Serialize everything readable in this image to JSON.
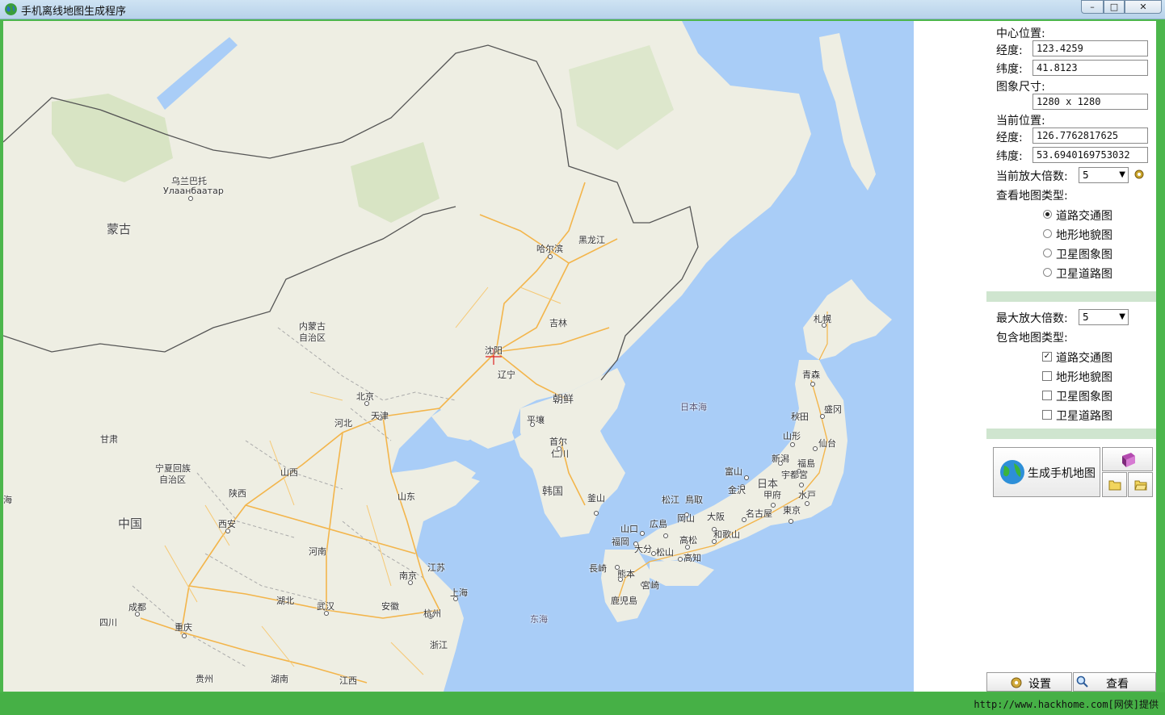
{
  "window": {
    "title": "手机离线地图生成程序",
    "controls": {
      "minimize": "–",
      "maximize": "□",
      "close": "✕"
    }
  },
  "map": {
    "labels": {
      "mongolia": "蒙古",
      "ulaanbaatar_cn": "乌兰巴托",
      "ulaanbaatar_ru": "Улаанбаатар",
      "inner_mongolia_1": "内蒙古",
      "inner_mongolia_2": "自治区",
      "heilongjiang": "黑龙江",
      "harbin": "哈尔滨",
      "jilin": "吉林",
      "shenyang": "沈阳",
      "liaoning": "辽宁",
      "beijing": "北京",
      "tianjin": "天津",
      "hebei": "河北",
      "gansu": "甘肃",
      "ningxia_1": "宁夏回族",
      "ningxia_2": "自治区",
      "shanxi": "山西",
      "shaanxi": "陕西",
      "shandong": "山东",
      "china": "中国",
      "xian": "西安",
      "henan": "河南",
      "jiangsu": "江苏",
      "nanjing": "南京",
      "shanghai": "上海",
      "hubei": "湖北",
      "wuhan": "武汉",
      "anhui": "安徽",
      "hangzhou": "杭州",
      "chengdu": "成都",
      "sichuan": "四川",
      "chongqing": "重庆",
      "zhejiang": "浙江",
      "guizhou": "贵州",
      "hunan": "湖南",
      "jiangxi": "江西",
      "sea_west": "海",
      "north_korea": "朝鲜",
      "pyongyang": "平壤",
      "seoul": "首尔",
      "incheon": "仁川",
      "south_korea": "韩国",
      "busan": "釜山",
      "sea_of_japan": "日本海",
      "east_sea": "东海",
      "sapporo": "札幌",
      "aomori": "青森",
      "akita": "秋田",
      "morioka": "盛冈",
      "yamagata": "山形",
      "sendai": "仙台",
      "niigata": "新潟",
      "fukushima": "福島",
      "toyama": "富山",
      "kanazawa": "金沢",
      "japan": "日本",
      "utsunomiya": "宇都宮",
      "kofu": "甲府",
      "mito": "水戸",
      "matsue": "松江",
      "tottori": "鳥取",
      "nagoya": "名古屋",
      "tokyo": "東京",
      "okayama": "岡山",
      "osaka": "大阪",
      "yamaguchi": "山口",
      "hiroshima": "広島",
      "wakayama": "和歌山",
      "fukuoka": "福岡",
      "takamatsu": "高松",
      "oita": "大分",
      "matsuyama": "松山",
      "nagasaki": "長崎",
      "kochi": "高知",
      "kumamoto": "熊本",
      "miyazaki": "宮崎",
      "kagoshima": "鹿児島"
    }
  },
  "panel": {
    "center_title": "中心位置:",
    "lon_label": "经度:",
    "lon_value": "123.4259",
    "lat_label": "纬度:",
    "lat_value": "41.8123",
    "size_title": "图象尺寸:",
    "size_value": "1280 x 1280",
    "current_title": "当前位置:",
    "cur_lon_label": "经度:",
    "cur_lon_value": "126.7762817625",
    "cur_lat_label": "纬度:",
    "cur_lat_value": "53.6940169753032",
    "zoom_label": "当前放大倍数:",
    "zoom_value": "5",
    "view_type_label": "查看地图类型:",
    "view_types": [
      "道路交通图",
      "地形地貌图",
      "卫星图象图",
      "卫星道路图"
    ],
    "view_selected": 0,
    "max_zoom_label": "最大放大倍数:",
    "max_zoom_value": "5",
    "include_label": "包含地图类型:",
    "include_types": [
      "道路交通图",
      "地形地貌图",
      "卫星图象图",
      "卫星道路图"
    ],
    "include_checked": [
      true,
      false,
      false,
      false
    ],
    "generate_button": "生成手机地图",
    "settings_button": "设置",
    "view_button": "查看"
  },
  "status": {
    "text": "http://www.hackhome.com[网侠]提供"
  },
  "colors": {
    "status_green": "#46b046",
    "sea": "#a9cdf7",
    "land": "#efefe5",
    "road": "#f3b54b"
  }
}
